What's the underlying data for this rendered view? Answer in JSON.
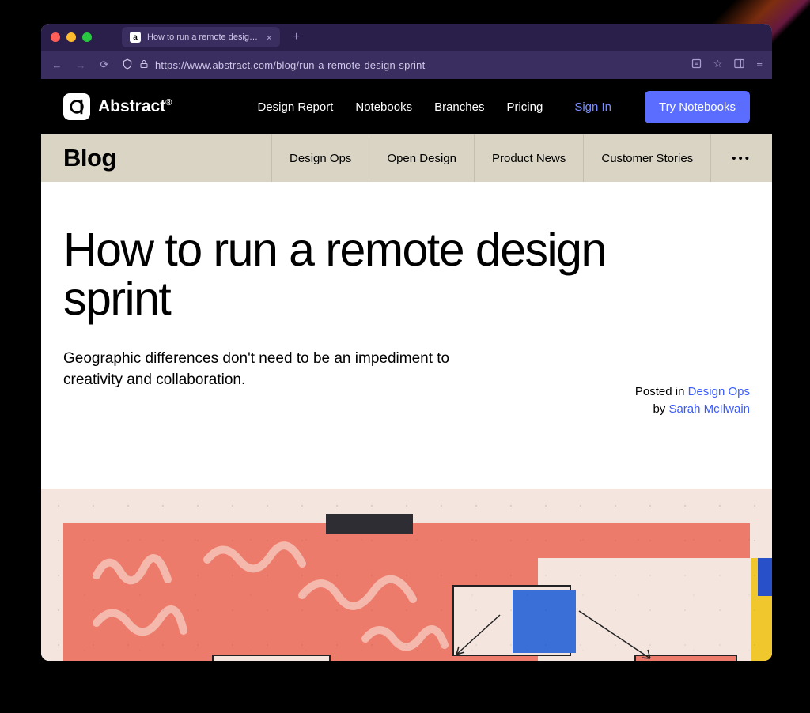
{
  "browser": {
    "tab_title": "How to run a remote design spri",
    "url": "https://www.abstract.com/blog/run-a-remote-design-sprint"
  },
  "site": {
    "brand": "Abstract",
    "brand_suffix": "®",
    "nav": {
      "design_report": "Design Report",
      "notebooks": "Notebooks",
      "branches": "Branches",
      "pricing": "Pricing"
    },
    "signin": "Sign In",
    "cta": "Try Notebooks"
  },
  "blog_nav": {
    "label": "Blog",
    "tabs": {
      "design_ops": "Design Ops",
      "open_design": "Open Design",
      "product_news": "Product News",
      "customer_stories": "Customer Stories",
      "more": "•••"
    }
  },
  "article": {
    "title": "How to run a remote design sprint",
    "subtitle": "Geographic differences don't need to be an impediment to creativity and collaboration.",
    "posted_in_label": "Posted in ",
    "category": "Design Ops",
    "by_label": "by ",
    "author": "Sarah McIlwain"
  }
}
